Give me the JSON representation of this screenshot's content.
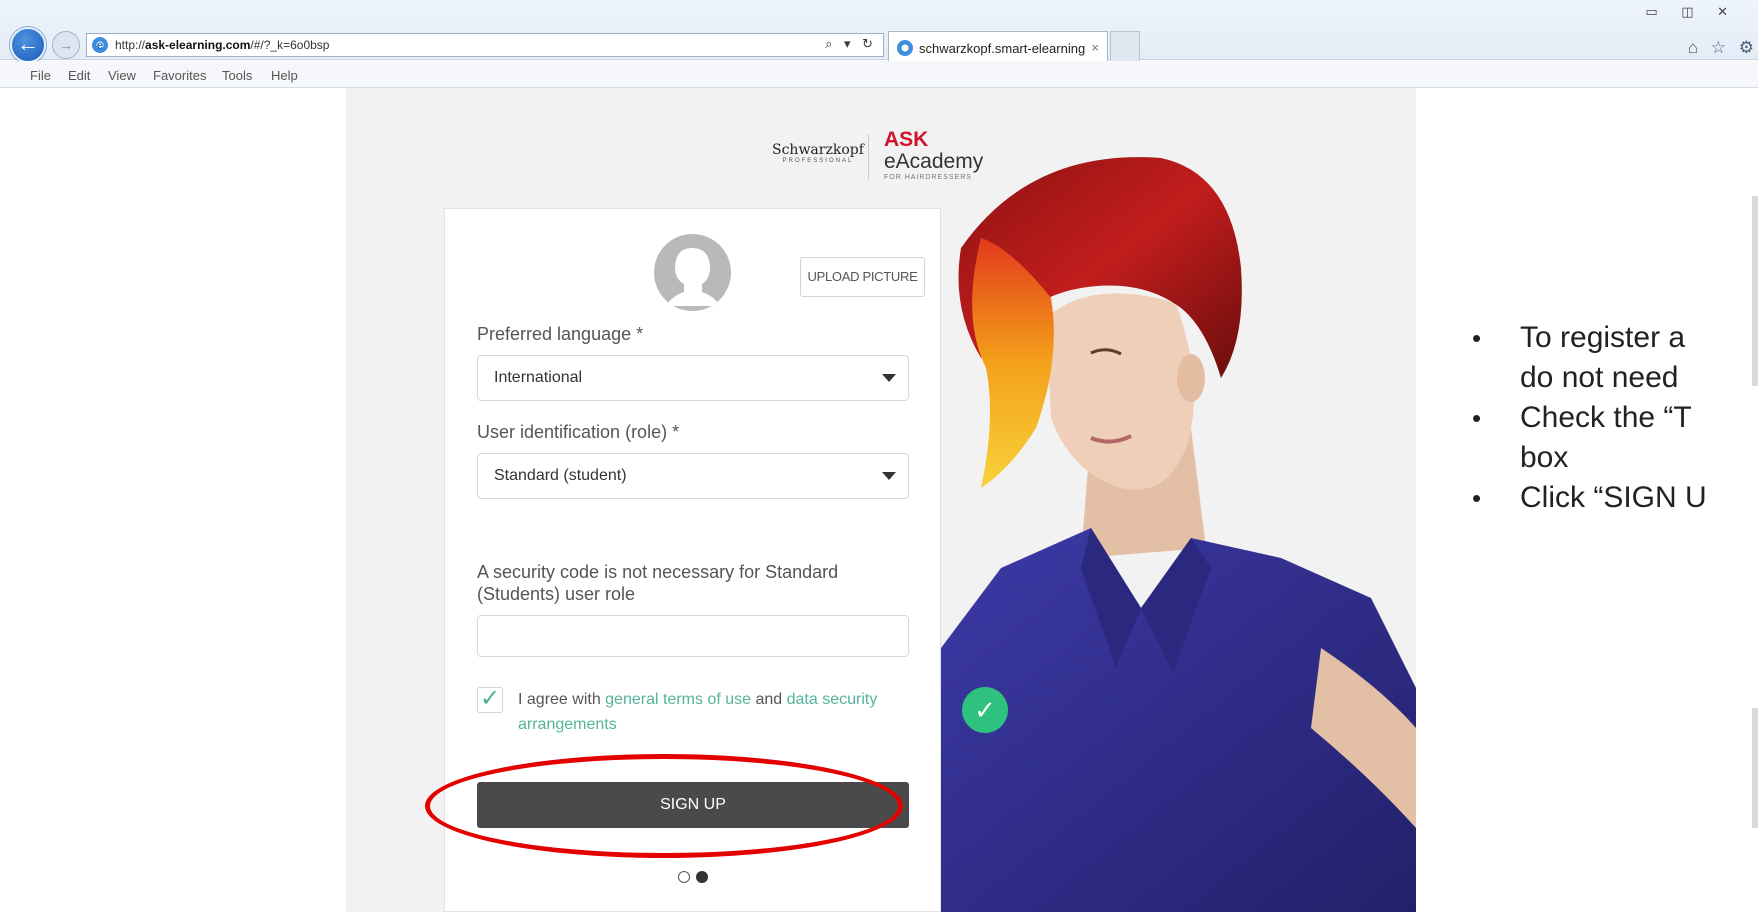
{
  "browser": {
    "url_prefix": "http://",
    "url_domain": "ask-elearning.com",
    "url_path": "/#/?_k=6o0bsp",
    "addr_tools": "⌕ ▾ ↻",
    "tab_title": "schwarzkopf.smart-elearning",
    "tab_close": "×",
    "window_controls": "▭ ◫ ✕",
    "toolbar_icons": "⌂ ☆ ⚙",
    "menu": [
      "File",
      "Edit",
      "View",
      "Favorites",
      "Tools",
      "Help"
    ]
  },
  "logo": {
    "brand": "Schwarzkopf",
    "brand_sub": "PROFESSIONAL",
    "ask": "ASK",
    "academy": "eAcademy",
    "tagline": "FOR HAIRDRESSERS"
  },
  "form": {
    "upload_label": "UPLOAD PICTURE",
    "language_label": "Preferred language *",
    "language_value": "International",
    "role_label": "User identification (role) *",
    "role_value": "Standard (student)",
    "security_label": "A security code is not necessary for Standard (Students) user role",
    "security_value": "",
    "agree_prefix": "I agree with ",
    "agree_terms": "general terms of use",
    "agree_and": " and ",
    "agree_data": "data security arrangements",
    "agree_checked": true,
    "signup_label": "SIGN UP"
  },
  "notes": [
    "To register a",
    "do not need",
    "Check the “T",
    "box",
    "Click “SIGN U"
  ],
  "colors": {
    "accent_green": "#55b39a",
    "brand_red": "#d0142b",
    "highlight_ring": "#e50000",
    "button_dark": "#4a4a4a"
  }
}
